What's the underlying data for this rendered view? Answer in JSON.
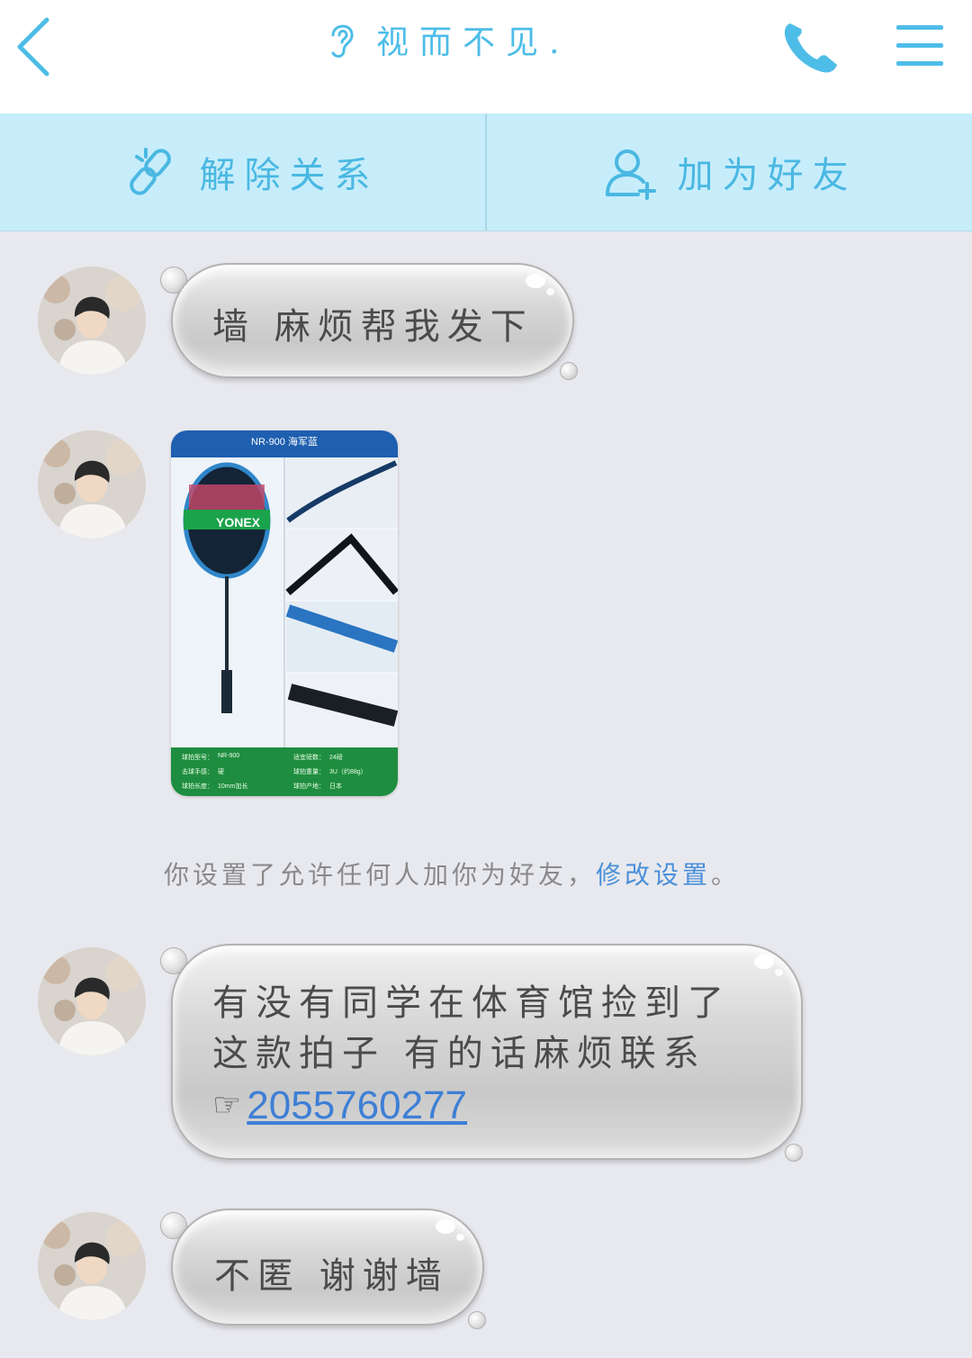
{
  "header": {
    "title": "视而不见.",
    "icons": {
      "back": "chevron-left-icon",
      "title": "ear-icon",
      "call": "phone-icon",
      "menu": "menu-icon"
    },
    "accent_color": "#4dbde8"
  },
  "actions": {
    "unlink_label": "解除关系",
    "add_friend_label": "加为好友",
    "bar_color": "#c7edfb"
  },
  "messages": [
    {
      "type": "text",
      "text": "墙 麻烦帮我发下"
    },
    {
      "type": "image",
      "image_title": "NR-900 海军蓝",
      "brand": "YONEX",
      "specs": [
        {
          "label": "球拍型号：",
          "value": "NR-900"
        },
        {
          "label": "适宜磅数：",
          "value": "24磅"
        },
        {
          "label": "击球手感：",
          "value": "硬"
        },
        {
          "label": "球拍重量：",
          "value": "3U（约88g）"
        },
        {
          "label": "球拍长度：",
          "value": "10mm加长"
        },
        {
          "label": "球拍产地：",
          "value": "日本"
        }
      ]
    },
    {
      "type": "text",
      "line1": "有没有同学在体育馆捡到了",
      "line2": "这款拍子 有的话麻烦联系",
      "pointer": "☞",
      "phone": "2055760277"
    },
    {
      "type": "text",
      "text": "不匿 谢谢墙"
    }
  ],
  "system_notice": {
    "text": "你设置了允许任何人加你为好友，",
    "link": "修改设置",
    "suffix": "。"
  }
}
